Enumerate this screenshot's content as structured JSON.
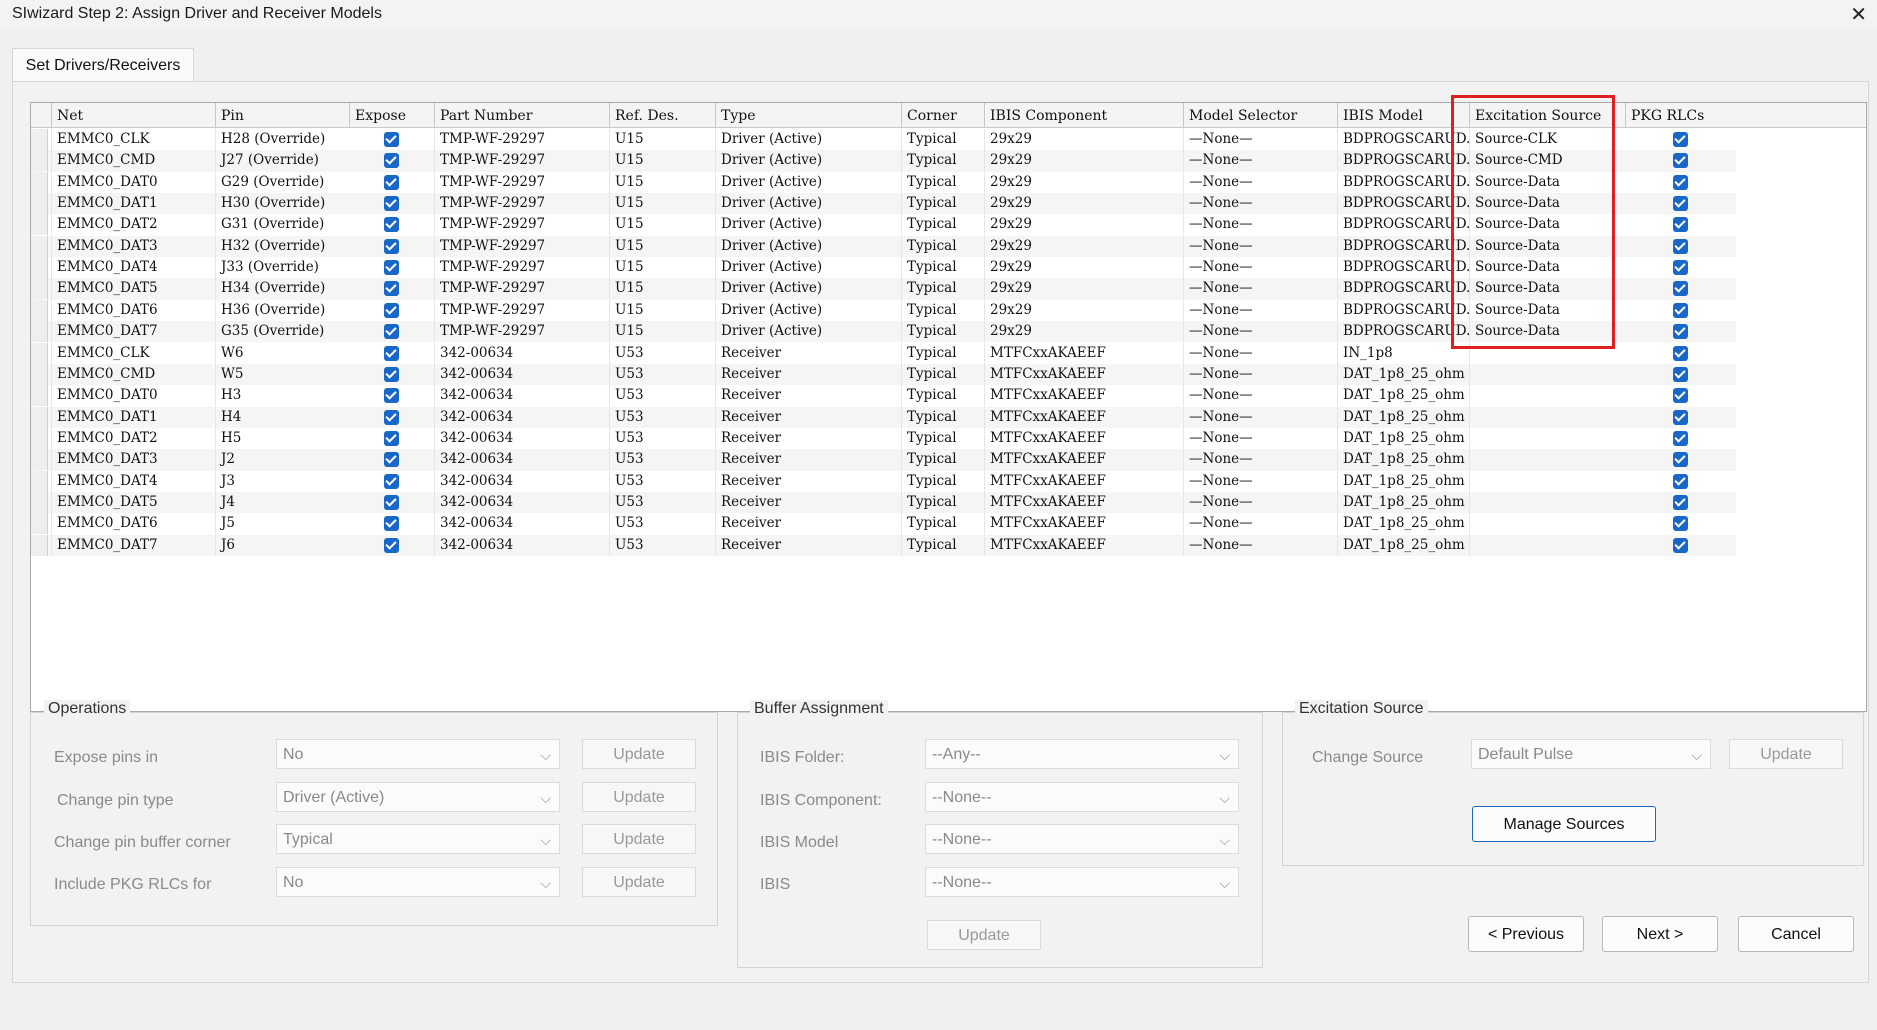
{
  "window": {
    "title": "SIwizard Step 2: Assign Driver and Receiver Models",
    "close_icon": "close-icon"
  },
  "tab": {
    "label": "Set Drivers/Receivers"
  },
  "table": {
    "columns": [
      "Net",
      "Pin",
      "Expose",
      "Part Number",
      "Ref. Des.",
      "Type",
      "Corner",
      "IBIS Component",
      "Model Selector",
      "IBIS Model",
      "Excitation Source",
      "PKG RLCs"
    ],
    "rows": [
      {
        "net": "EMMC0_CLK",
        "pin": "H28 (Override)",
        "expose": true,
        "part": "TMP-WF-29297",
        "ref": "U15",
        "type": "Driver (Active)",
        "corner": "Typical",
        "ibis_comp": "29x29",
        "selector": "—None—",
        "model": "BDPROGSCARUD..",
        "source": "Source-CLK",
        "pkg": true
      },
      {
        "net": "EMMC0_CMD",
        "pin": "J27 (Override)",
        "expose": true,
        "part": "TMP-WF-29297",
        "ref": "U15",
        "type": "Driver (Active)",
        "corner": "Typical",
        "ibis_comp": "29x29",
        "selector": "—None—",
        "model": "BDPROGSCARUD..",
        "source": "Source-CMD",
        "pkg": true
      },
      {
        "net": "EMMC0_DAT0",
        "pin": "G29 (Override)",
        "expose": true,
        "part": "TMP-WF-29297",
        "ref": "U15",
        "type": "Driver (Active)",
        "corner": "Typical",
        "ibis_comp": "29x29",
        "selector": "—None—",
        "model": "BDPROGSCARUD..",
        "source": "Source-Data",
        "pkg": true
      },
      {
        "net": "EMMC0_DAT1",
        "pin": "H30 (Override)",
        "expose": true,
        "part": "TMP-WF-29297",
        "ref": "U15",
        "type": "Driver (Active)",
        "corner": "Typical",
        "ibis_comp": "29x29",
        "selector": "—None—",
        "model": "BDPROGSCARUD..",
        "source": "Source-Data",
        "pkg": true
      },
      {
        "net": "EMMC0_DAT2",
        "pin": "G31 (Override)",
        "expose": true,
        "part": "TMP-WF-29297",
        "ref": "U15",
        "type": "Driver (Active)",
        "corner": "Typical",
        "ibis_comp": "29x29",
        "selector": "—None—",
        "model": "BDPROGSCARUD..",
        "source": "Source-Data",
        "pkg": true
      },
      {
        "net": "EMMC0_DAT3",
        "pin": "H32 (Override)",
        "expose": true,
        "part": "TMP-WF-29297",
        "ref": "U15",
        "type": "Driver (Active)",
        "corner": "Typical",
        "ibis_comp": "29x29",
        "selector": "—None—",
        "model": "BDPROGSCARUD..",
        "source": "Source-Data",
        "pkg": true
      },
      {
        "net": "EMMC0_DAT4",
        "pin": "J33 (Override)",
        "expose": true,
        "part": "TMP-WF-29297",
        "ref": "U15",
        "type": "Driver (Active)",
        "corner": "Typical",
        "ibis_comp": "29x29",
        "selector": "—None—",
        "model": "BDPROGSCARUD..",
        "source": "Source-Data",
        "pkg": true
      },
      {
        "net": "EMMC0_DAT5",
        "pin": "H34 (Override)",
        "expose": true,
        "part": "TMP-WF-29297",
        "ref": "U15",
        "type": "Driver (Active)",
        "corner": "Typical",
        "ibis_comp": "29x29",
        "selector": "—None—",
        "model": "BDPROGSCARUD..",
        "source": "Source-Data",
        "pkg": true
      },
      {
        "net": "EMMC0_DAT6",
        "pin": "H36 (Override)",
        "expose": true,
        "part": "TMP-WF-29297",
        "ref": "U15",
        "type": "Driver (Active)",
        "corner": "Typical",
        "ibis_comp": "29x29",
        "selector": "—None—",
        "model": "BDPROGSCARUD..",
        "source": "Source-Data",
        "pkg": true
      },
      {
        "net": "EMMC0_DAT7",
        "pin": "G35 (Override)",
        "expose": true,
        "part": "TMP-WF-29297",
        "ref": "U15",
        "type": "Driver (Active)",
        "corner": "Typical",
        "ibis_comp": "29x29",
        "selector": "—None—",
        "model": "BDPROGSCARUD..",
        "source": "Source-Data",
        "pkg": true
      },
      {
        "net": "EMMC0_CLK",
        "pin": "W6",
        "expose": true,
        "part": "342-00634",
        "ref": "U53",
        "type": "Receiver",
        "corner": "Typical",
        "ibis_comp": "MTFCxxAKAEEF",
        "selector": "—None—",
        "model": "IN_1p8",
        "source": "",
        "pkg": true
      },
      {
        "net": "EMMC0_CMD",
        "pin": "W5",
        "expose": true,
        "part": "342-00634",
        "ref": "U53",
        "type": "Receiver",
        "corner": "Typical",
        "ibis_comp": "MTFCxxAKAEEF",
        "selector": "—None—",
        "model": "DAT_1p8_25_ohm",
        "source": "",
        "pkg": true
      },
      {
        "net": "EMMC0_DAT0",
        "pin": "H3",
        "expose": true,
        "part": "342-00634",
        "ref": "U53",
        "type": "Receiver",
        "corner": "Typical",
        "ibis_comp": "MTFCxxAKAEEF",
        "selector": "—None—",
        "model": "DAT_1p8_25_ohm",
        "source": "",
        "pkg": true
      },
      {
        "net": "EMMC0_DAT1",
        "pin": "H4",
        "expose": true,
        "part": "342-00634",
        "ref": "U53",
        "type": "Receiver",
        "corner": "Typical",
        "ibis_comp": "MTFCxxAKAEEF",
        "selector": "—None—",
        "model": "DAT_1p8_25_ohm",
        "source": "",
        "pkg": true
      },
      {
        "net": "EMMC0_DAT2",
        "pin": "H5",
        "expose": true,
        "part": "342-00634",
        "ref": "U53",
        "type": "Receiver",
        "corner": "Typical",
        "ibis_comp": "MTFCxxAKAEEF",
        "selector": "—None—",
        "model": "DAT_1p8_25_ohm",
        "source": "",
        "pkg": true
      },
      {
        "net": "EMMC0_DAT3",
        "pin": "J2",
        "expose": true,
        "part": "342-00634",
        "ref": "U53",
        "type": "Receiver",
        "corner": "Typical",
        "ibis_comp": "MTFCxxAKAEEF",
        "selector": "—None—",
        "model": "DAT_1p8_25_ohm",
        "source": "",
        "pkg": true
      },
      {
        "net": "EMMC0_DAT4",
        "pin": "J3",
        "expose": true,
        "part": "342-00634",
        "ref": "U53",
        "type": "Receiver",
        "corner": "Typical",
        "ibis_comp": "MTFCxxAKAEEF",
        "selector": "—None—",
        "model": "DAT_1p8_25_ohm",
        "source": "",
        "pkg": true
      },
      {
        "net": "EMMC0_DAT5",
        "pin": "J4",
        "expose": true,
        "part": "342-00634",
        "ref": "U53",
        "type": "Receiver",
        "corner": "Typical",
        "ibis_comp": "MTFCxxAKAEEF",
        "selector": "—None—",
        "model": "DAT_1p8_25_ohm",
        "source": "",
        "pkg": true
      },
      {
        "net": "EMMC0_DAT6",
        "pin": "J5",
        "expose": true,
        "part": "342-00634",
        "ref": "U53",
        "type": "Receiver",
        "corner": "Typical",
        "ibis_comp": "MTFCxxAKAEEF",
        "selector": "—None—",
        "model": "DAT_1p8_25_ohm",
        "source": "",
        "pkg": true
      },
      {
        "net": "EMMC0_DAT7",
        "pin": "J6",
        "expose": true,
        "part": "342-00634",
        "ref": "U53",
        "type": "Receiver",
        "corner": "Typical",
        "ibis_comp": "MTFCxxAKAEEF",
        "selector": "—None—",
        "model": "DAT_1p8_25_ohm",
        "source": "",
        "pkg": true
      }
    ]
  },
  "operations": {
    "title": "Operations",
    "expose_label": "Expose pins in",
    "expose_value": "No",
    "pintype_label": "Change pin type",
    "pintype_value": "Driver (Active)",
    "corner_label": "Change pin buffer corner",
    "corner_value": "Typical",
    "pkg_label": "Include PKG RLCs for",
    "pkg_value": "No",
    "update_label": "Update"
  },
  "buffer": {
    "title": "Buffer Assignment",
    "folder_label": "IBIS Folder:",
    "folder_value": "--Any--",
    "component_label": "IBIS Component:",
    "component_value": "--None--",
    "model_label": "IBIS Model",
    "model_value": "--None--",
    "ibis_label": "IBIS",
    "ibis_value": "--None--",
    "update_label": "Update"
  },
  "excitation": {
    "title": "Excitation Source",
    "change_label": "Change Source",
    "change_value": "Default Pulse",
    "update_label": "Update",
    "manage_label": "Manage Sources"
  },
  "footer": {
    "previous": "< Previous",
    "next": "Next >",
    "cancel": "Cancel"
  },
  "colors": {
    "accent": "#1967c7",
    "highlight": "#e02020"
  }
}
